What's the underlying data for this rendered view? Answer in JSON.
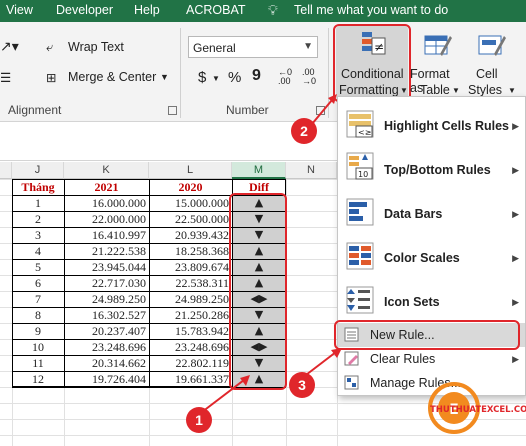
{
  "menu": [
    "View",
    "Developer",
    "Help",
    "ACROBAT",
    "Tell me what you want to do"
  ],
  "ribbon": {
    "wrap_text": "Wrap Text",
    "merge_center": "Merge & Center",
    "alignment_label": "Alignment",
    "number_format": "General",
    "number_label": "Number",
    "currency_symbol": "$",
    "percent_symbol": "%",
    "comma_symbol": "9",
    "cf_line1": "Conditional",
    "cf_line2": "Formatting",
    "fat_line1": "Format as",
    "fat_line2": "Table",
    "cs_line1": "Cell",
    "cs_line2": "Styles"
  },
  "columns": [
    "J",
    "K",
    "L",
    "M",
    "N"
  ],
  "table": {
    "headers": [
      "Tháng",
      "2021",
      "2020",
      "Diff"
    ],
    "rows": [
      {
        "month": "1",
        "y2021": "16.000.000",
        "y2020": "15.000.000",
        "diff": "▲"
      },
      {
        "month": "2",
        "y2021": "22.000.000",
        "y2020": "22.500.000",
        "diff": "▼"
      },
      {
        "month": "3",
        "y2021": "16.410.997",
        "y2020": "20.939.432",
        "diff": "▼"
      },
      {
        "month": "4",
        "y2021": "21.222.538",
        "y2020": "18.258.368",
        "diff": "▲"
      },
      {
        "month": "5",
        "y2021": "23.945.044",
        "y2020": "23.809.674",
        "diff": "▲"
      },
      {
        "month": "6",
        "y2021": "22.717.030",
        "y2020": "22.538.311",
        "diff": "▲"
      },
      {
        "month": "7",
        "y2021": "24.989.250",
        "y2020": "24.989.250",
        "diff": "◀▶"
      },
      {
        "month": "8",
        "y2021": "16.302.527",
        "y2020": "21.250.286",
        "diff": "▼"
      },
      {
        "month": "9",
        "y2021": "20.237.407",
        "y2020": "15.783.942",
        "diff": "▲"
      },
      {
        "month": "10",
        "y2021": "23.248.696",
        "y2020": "23.248.696",
        "diff": "◀▶"
      },
      {
        "month": "11",
        "y2021": "20.314.662",
        "y2020": "22.802.119",
        "diff": "▼"
      },
      {
        "month": "12",
        "y2021": "19.726.404",
        "y2020": "19.661.337",
        "diff": "▲"
      }
    ]
  },
  "dropdown": {
    "highlight": "Highlight Cells Rules",
    "topbottom": "Top/Bottom Rules",
    "databars": "Data Bars",
    "colorscales": "Color Scales",
    "iconsets": "Icon Sets",
    "newrule": "New Rule...",
    "clearrules": "Clear Rules",
    "managerules": "Manage Rules..."
  },
  "callouts": [
    "1",
    "2",
    "3"
  ],
  "logo_text": "THUTHUATEXCEL.COM",
  "colors": {
    "excel_green": "#217346",
    "callout_red": "#e0262b",
    "header_red": "#c00000"
  }
}
